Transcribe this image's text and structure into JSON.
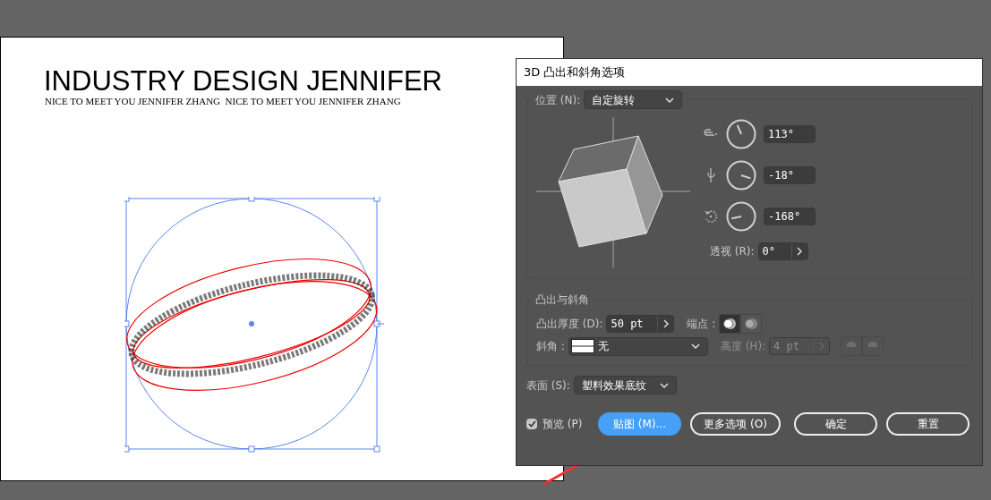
{
  "document": {
    "heading": "INDUSTRY DESIGN JENNIFER",
    "subheading": "NICE TO MEET YOU JENNIFER ZHANG  NICE TO MEET YOU JENNIFER ZHANG"
  },
  "dialog": {
    "title": "3D 凸出和斜角选项",
    "position": {
      "label": "位置 (N):",
      "value": "自定旋转"
    },
    "rotations": [
      {
        "kind": "x",
        "value": "113°"
      },
      {
        "kind": "y",
        "value": "-18°"
      },
      {
        "kind": "z",
        "value": "-168°"
      }
    ],
    "perspective": {
      "label": "透视 (R):",
      "value": "0°"
    },
    "extrude": {
      "title": "凸出与斜角",
      "depth_label": "凸出厚度 (D):",
      "depth_value": "50 pt",
      "cap_label": "端点 :",
      "caps": [
        {
          "kind": "on",
          "selected": true
        },
        {
          "kind": "off",
          "selected": false
        }
      ],
      "bevel_label": "斜角 :",
      "bevel_value": "无",
      "height_label": "高度 (H):",
      "height_value": "4 pt",
      "height_disabled": true
    },
    "surface": {
      "label": "表面 (S):",
      "value": "塑料效果底纹"
    },
    "preview": {
      "label": "预览 (P)",
      "checked": true
    },
    "buttons": [
      {
        "kind": "primary",
        "label": "贴图 (M)..."
      },
      {
        "kind": "outline",
        "label": "更多选项 (O)"
      },
      {
        "kind": "outline",
        "label": "确定"
      },
      {
        "kind": "outline",
        "label": "重置"
      }
    ]
  }
}
